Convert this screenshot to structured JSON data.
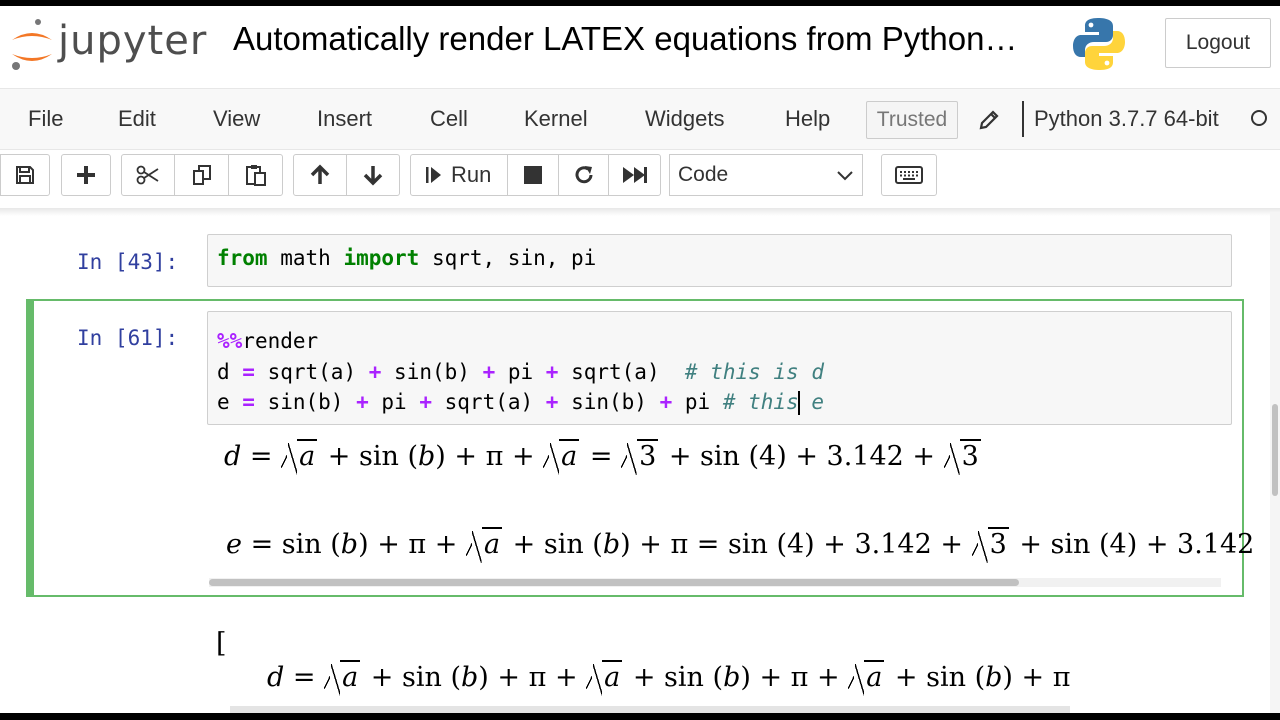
{
  "header": {
    "logo_text": "jupyter",
    "notebook_title": "Automatically render LATEX equations from Python…",
    "logout_label": "Logout"
  },
  "menubar": {
    "items": [
      "File",
      "Edit",
      "View",
      "Insert",
      "Cell",
      "Kernel",
      "Widgets",
      "Help"
    ],
    "trusted_label": "Trusted",
    "kernel_name": "Python 3.7.7 64-bit"
  },
  "toolbar": {
    "run_label": "Run",
    "cell_type": "Code",
    "icons": [
      "save-icon",
      "plus-icon",
      "cut-icon",
      "copy-icon",
      "paste-icon",
      "arrow-up-icon",
      "arrow-down-icon",
      "run-icon",
      "stop-icon",
      "restart-icon",
      "fast-forward-icon",
      "keyboard-icon"
    ]
  },
  "cells": [
    {
      "prompt": "In [43]:",
      "code": {
        "kw1": "from",
        "mod": " math ",
        "kw2": "import",
        "rest": " sqrt, sin, pi"
      }
    },
    {
      "prompt": "In [61]:",
      "magic_op": "%%",
      "magic_name": "render",
      "line2": {
        "lhs": "d ",
        "eq": "=",
        "a1": " sqrt(a) ",
        "p1": "+",
        "a2": " sin(b) ",
        "p2": "+",
        "a3": " pi ",
        "p3": "+",
        "a4": " sqrt(a)  ",
        "comment": "# this is d"
      },
      "line3": {
        "lhs": "e ",
        "eq": "=",
        "a1": " sin(b) ",
        "p1": "+",
        "a2": " pi ",
        "p2": "+",
        "a3": " sqrt(a) ",
        "p3": "+",
        "a4": " sin(b) ",
        "p4": "+",
        "a5": " pi ",
        "comment_a": "# this",
        "comment_b": " e"
      },
      "output": {
        "eq_d": {
          "lhs": "d",
          "mid1": " + sin (",
          "b": "b",
          "mid2": ") + π + ",
          "mid3": " = ",
          "three": "3",
          "mid4": " + sin (4) + 3.142 + "
        },
        "eq_e": {
          "lhs": "e",
          "mid1": " = sin (",
          "b": "b",
          "mid2": ") + π + ",
          "mid3": " + sin (",
          "mid4": ") + π = sin (4) + 3.142 + ",
          "tail": " + sin (4) + 3.142"
        }
      }
    }
  ],
  "next_output": {
    "bracket": "[",
    "eq": {
      "lhs": "d",
      "s1": " + sin (",
      "b": "b",
      "s2": ") + π + "
    }
  },
  "colors": {
    "accent_green": "#66bb6a",
    "prompt_blue": "#303f9f",
    "keyword_green": "#008000",
    "operator_purple": "#aa22ff",
    "comment_teal": "#408080"
  }
}
